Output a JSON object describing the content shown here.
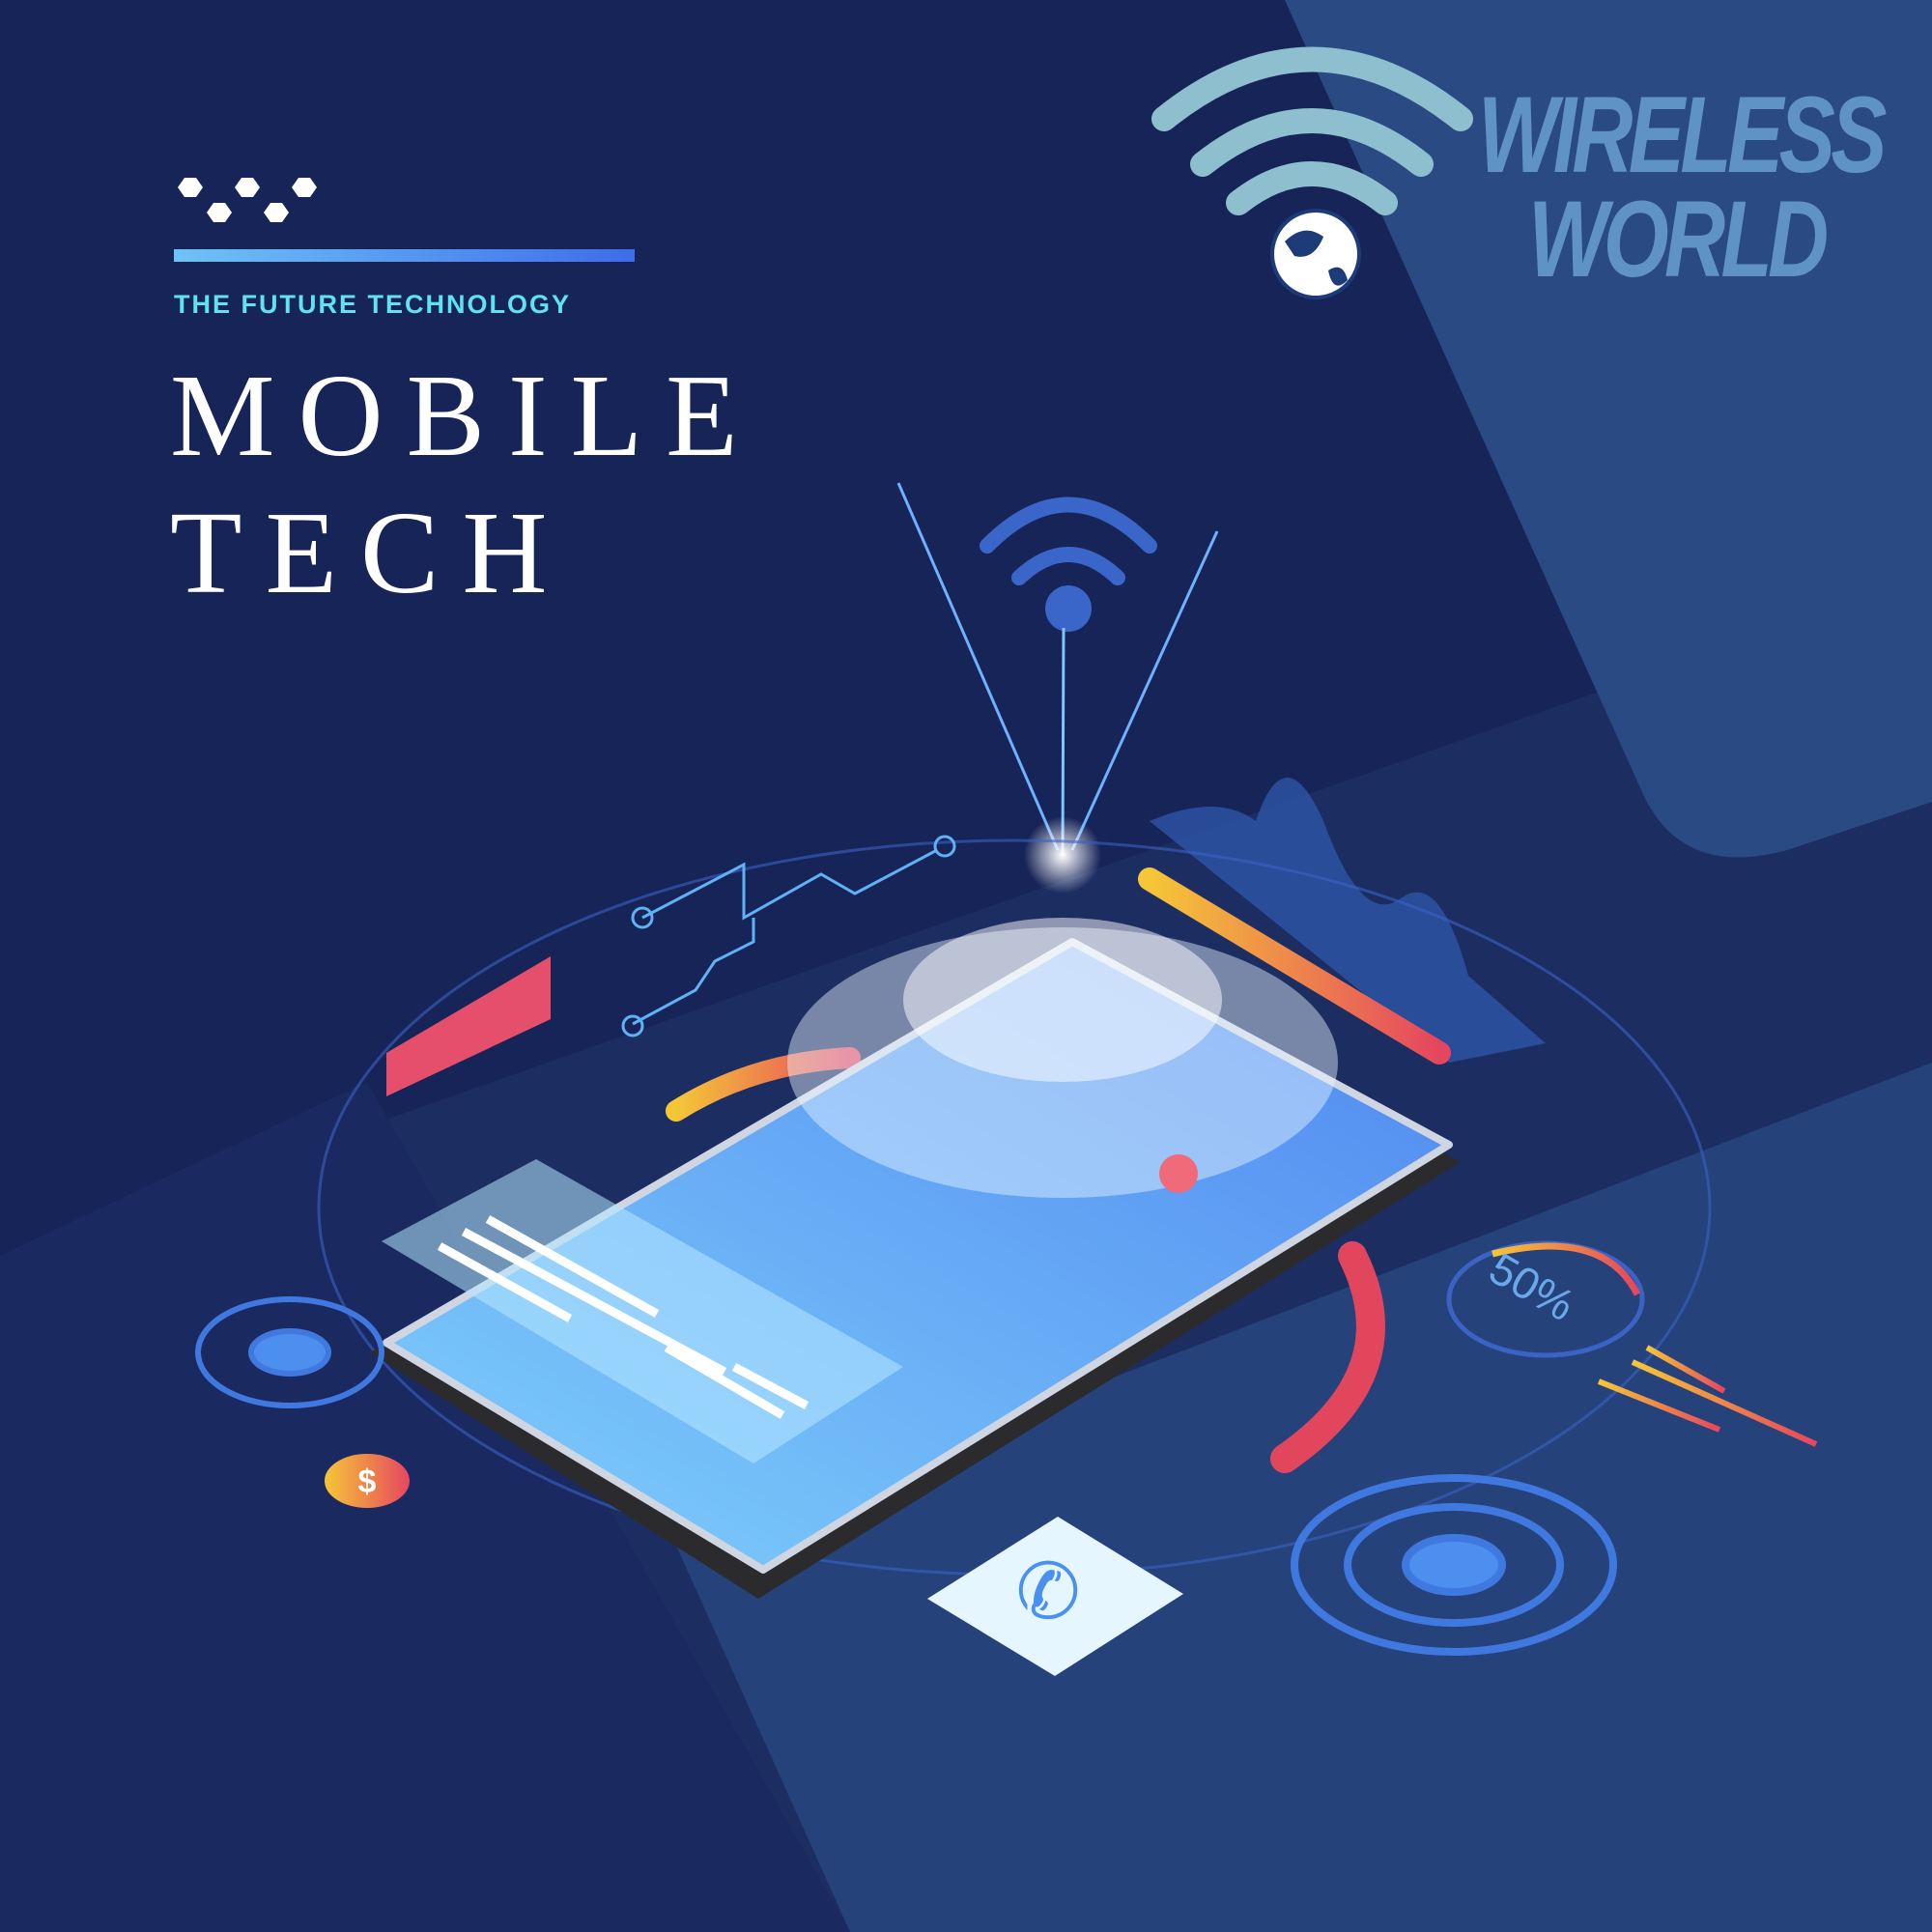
{
  "header": {
    "tagline": "THE FUTURE TECHNOLOGY",
    "title_line1": "MOBILE",
    "title_line2": "TECH"
  },
  "logo": {
    "line1": "WIRELESS",
    "line2": "WORLD"
  },
  "gauge": {
    "label": "50%",
    "value": 50
  },
  "colors": {
    "background": "#1c2d62",
    "accent_cyan": "#5fe3f0",
    "logo_blue": "#5f93c6",
    "screen_blue": "#6cb8f6"
  }
}
